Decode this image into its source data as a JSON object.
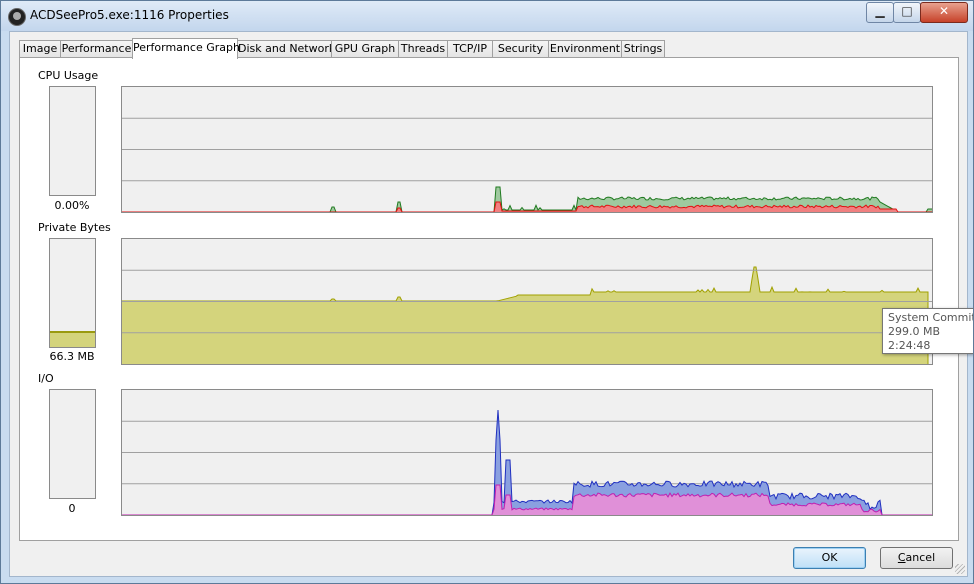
{
  "window": {
    "title": "ACDSeePro5.exe:1116 Properties"
  },
  "title_buttons": {
    "minimize": "▁",
    "maximize": "□",
    "close": "✕"
  },
  "tabs": [
    {
      "label": "Image"
    },
    {
      "label": "Performance"
    },
    {
      "label": "Performance Graph"
    },
    {
      "label": "Disk and Network"
    },
    {
      "label": "GPU Graph"
    },
    {
      "label": "Threads"
    },
    {
      "label": "TCP/IP"
    },
    {
      "label": "Security"
    },
    {
      "label": "Environment"
    },
    {
      "label": "Strings"
    }
  ],
  "active_tab": "Performance Graph",
  "sections": {
    "cpu": {
      "label": "CPU Usage",
      "value": "0.00%"
    },
    "private_bytes": {
      "label": "Private Bytes",
      "value": "66.3 MB"
    },
    "io": {
      "label": "I/O",
      "value": "0"
    }
  },
  "tooltip": {
    "title": "System Commit",
    "value": "299.0 MB",
    "time": "2:24:48"
  },
  "buttons": {
    "ok": "OK",
    "cancel": "Cancel",
    "cancel_accesskey": "C"
  },
  "colors": {
    "graph_bg": "#f0f0f0",
    "grid": "#a0a0a0",
    "cpu_total_fill": "#9fc99f",
    "cpu_total_line": "#207a20",
    "cpu_kernel_fill": "#f08080",
    "cpu_kernel_line": "#e01010",
    "private_fill": "#d4d47c",
    "private_line": "#a0a000",
    "io_total_fill": "#8aa0e0",
    "io_total_line": "#2030c0",
    "io_other_fill": "#e090d8",
    "io_other_line": "#c020b0"
  }
}
